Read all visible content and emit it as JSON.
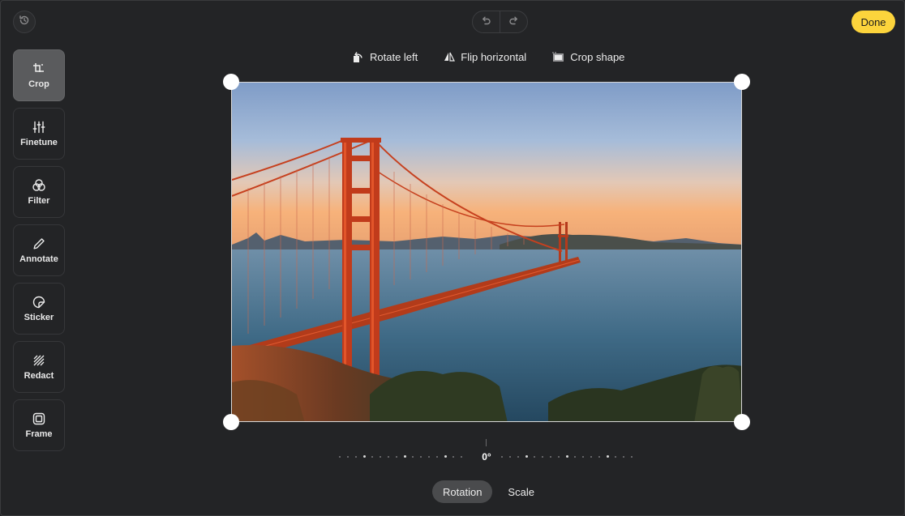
{
  "topbar": {
    "history_icon": "history-icon",
    "undo_icon": "undo-icon",
    "redo_icon": "redo-icon",
    "done_label": "Done",
    "accent": "#fcd43c"
  },
  "sidebar": {
    "items": [
      {
        "label": "Crop",
        "icon": "crop-icon",
        "active": true
      },
      {
        "label": "Finetune",
        "icon": "sliders-icon",
        "active": false
      },
      {
        "label": "Filter",
        "icon": "filter-circles-icon",
        "active": false
      },
      {
        "label": "Annotate",
        "icon": "pencil-icon",
        "active": false
      },
      {
        "label": "Sticker",
        "icon": "sticker-icon",
        "active": false
      },
      {
        "label": "Redact",
        "icon": "redact-hatch-icon",
        "active": false
      },
      {
        "label": "Frame",
        "icon": "frame-icon",
        "active": false
      }
    ]
  },
  "crop_toolbar": {
    "rotate_left": "Rotate left",
    "flip_horizontal": "Flip horizontal",
    "crop_shape": "Crop shape"
  },
  "image": {
    "subject": "golden-gate-bridge-photo"
  },
  "dial": {
    "value": "0°"
  },
  "bottom_tabs": {
    "rotation": "Rotation",
    "scale": "Scale",
    "active": "Rotation"
  }
}
